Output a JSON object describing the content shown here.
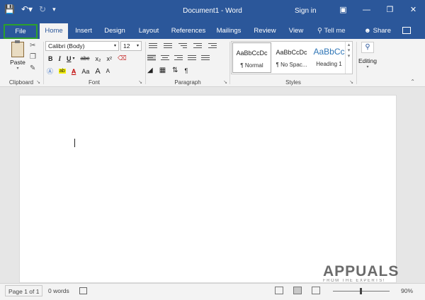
{
  "titlebar": {
    "title": "Document1  -  Word",
    "signin": "Sign in",
    "qat": {
      "save_icon": "save-icon",
      "undo_icon": "undo-icon",
      "redo_icon": "redo-icon",
      "customize_icon": "customize-qat-icon"
    }
  },
  "tabs": [
    {
      "label": "File"
    },
    {
      "label": "Home"
    },
    {
      "label": "Insert"
    },
    {
      "label": "Design"
    },
    {
      "label": "Layout"
    },
    {
      "label": "References"
    },
    {
      "label": "Mailings"
    },
    {
      "label": "Review"
    },
    {
      "label": "View"
    }
  ],
  "tell_me": "Tell me",
  "share": "Share",
  "ribbon": {
    "clipboard": {
      "label": "Clipboard",
      "paste": "Paste"
    },
    "font": {
      "label": "Font",
      "font_name": "Calibri (Body)",
      "font_size": "12",
      "bold": "B",
      "italic": "I",
      "underline": "U",
      "strike": "abc",
      "sub": "x₂",
      "sup": "x²",
      "case": "Aa",
      "grow": "A",
      "shrink": "A"
    },
    "paragraph": {
      "label": "Paragraph",
      "pilcrow": "¶"
    },
    "styles": {
      "label": "Styles",
      "items": [
        {
          "sample": "AaBbCcDc",
          "name": "¶ Normal"
        },
        {
          "sample": "AaBbCcDc",
          "name": "¶ No Spac..."
        },
        {
          "sample": "AaBbCc",
          "name": "Heading 1"
        }
      ]
    },
    "editing": {
      "label": "Editing"
    }
  },
  "statusbar": {
    "page": "Page 1 of 1",
    "words": "0 words",
    "zoom": "90%"
  },
  "watermark": {
    "logo": "APPUALS",
    "tagline": "FROM THE EXPERTS!"
  },
  "colors": {
    "accent": "#2b579a",
    "file_highlight": "#2ca02c"
  }
}
